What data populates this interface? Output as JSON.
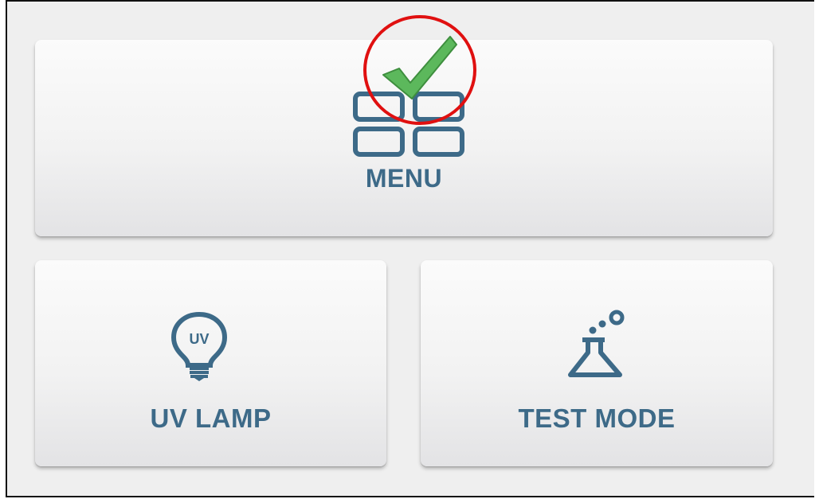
{
  "tiles": {
    "menu": {
      "label": "MENU",
      "icon": "grid-icon"
    },
    "uv_lamp": {
      "label": "UV LAMP",
      "icon": "uv-bulb-icon",
      "icon_text": "UV"
    },
    "test_mode": {
      "label": "TEST MODE",
      "icon": "flask-icon"
    }
  },
  "annotation": {
    "icon": "checkmark-icon",
    "ring": "red-circle",
    "ring_color": "#e01010",
    "check_color": "#5cb85c"
  },
  "colors": {
    "accent": "#3d6a88",
    "background": "#efefef"
  }
}
